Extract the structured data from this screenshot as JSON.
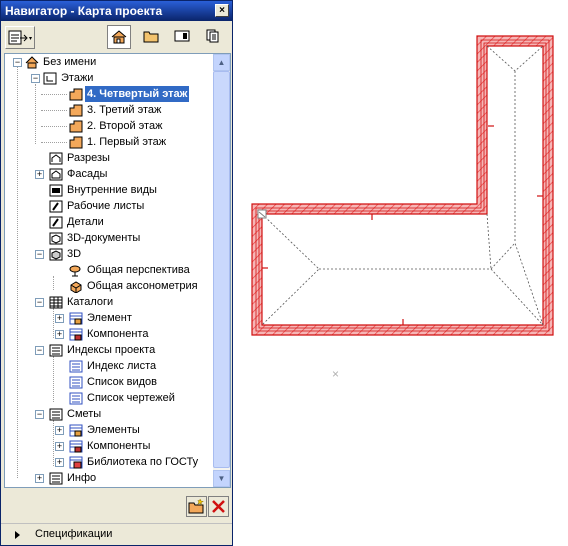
{
  "window": {
    "title": "Навигатор - Карта проекта",
    "close_glyph": "×"
  },
  "toolbar": {
    "mode_icon": "navigator-mode-icon",
    "tabs": [
      {
        "name": "project-map-icon"
      },
      {
        "name": "view-map-icon"
      },
      {
        "name": "layout-book-icon"
      },
      {
        "name": "publisher-sets-icon"
      }
    ]
  },
  "tree": {
    "root": "Без имени",
    "floors": "Этажи",
    "floor_items": [
      "4. Четвертый этаж",
      "3. Третий этаж",
      "2. Второй этаж",
      "1. Первый этаж"
    ],
    "sections": "Разрезы",
    "elevations": "Фасады",
    "interior": "Внутренние виды",
    "worksheets": "Рабочие листы",
    "details": "Детали",
    "docs3d": "3D-документы",
    "view3d": "3D",
    "perspective": "Общая перспектива",
    "axonometry": "Общая аксонометрия",
    "catalogs": "Каталоги",
    "cat_element": "Элемент",
    "cat_component": "Компонента",
    "indexes": "Индексы проекта",
    "idx_sheet": "Индекс листа",
    "idx_views": "Список видов",
    "idx_drawings": "Список чертежей",
    "estimates": "Сметы",
    "est_elements": "Элементы",
    "est_components": "Компоненты",
    "est_gost": "Библиотека по ГОСТу",
    "info": "Инфо",
    "expand_plus": "+",
    "expand_minus": "−"
  },
  "bottom": {
    "specifications": "Спецификации"
  },
  "colors": {
    "wall_hatch": "#e83a3a",
    "wall_fill": "#f6b6b6",
    "selection": "#316ac5",
    "titlebar": "#0a246a"
  },
  "canvas": {
    "origin_marker": "×"
  }
}
